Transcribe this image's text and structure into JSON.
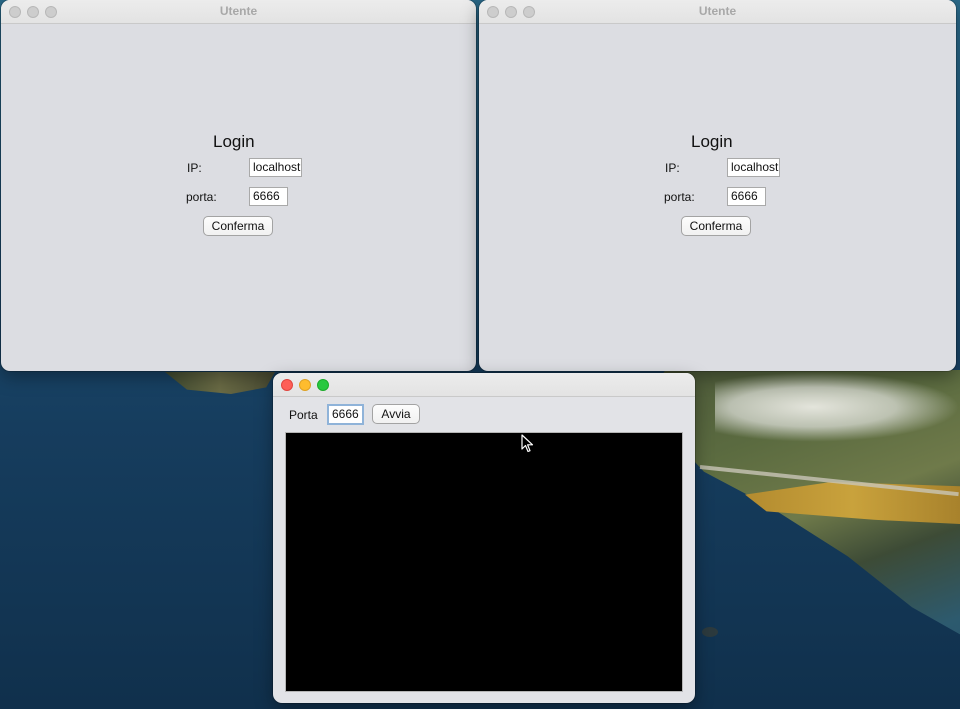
{
  "login_windows": [
    {
      "title": "Utente",
      "heading": "Login",
      "ip_label": "IP:",
      "ip_value": "localhost",
      "port_label": "porta:",
      "port_value": "6666",
      "confirm_label": "Conferma"
    },
    {
      "title": "Utente",
      "heading": "Login",
      "ip_label": "IP:",
      "ip_value": "localhost",
      "port_label": "porta:",
      "port_value": "6666",
      "confirm_label": "Conferma"
    }
  ],
  "server_window": {
    "title": "",
    "port_label": "Porta",
    "port_value": "6666",
    "start_label": "Avvia",
    "console_text": ""
  },
  "colors": {
    "window_bg": "#dcdde2",
    "console_bg": "#000000",
    "traffic_red": "#fe5f57",
    "traffic_yellow": "#febc2e",
    "traffic_green": "#28c840"
  },
  "icons": [
    "close-icon",
    "minimize-icon",
    "zoom-icon",
    "mouse-pointer-icon"
  ]
}
